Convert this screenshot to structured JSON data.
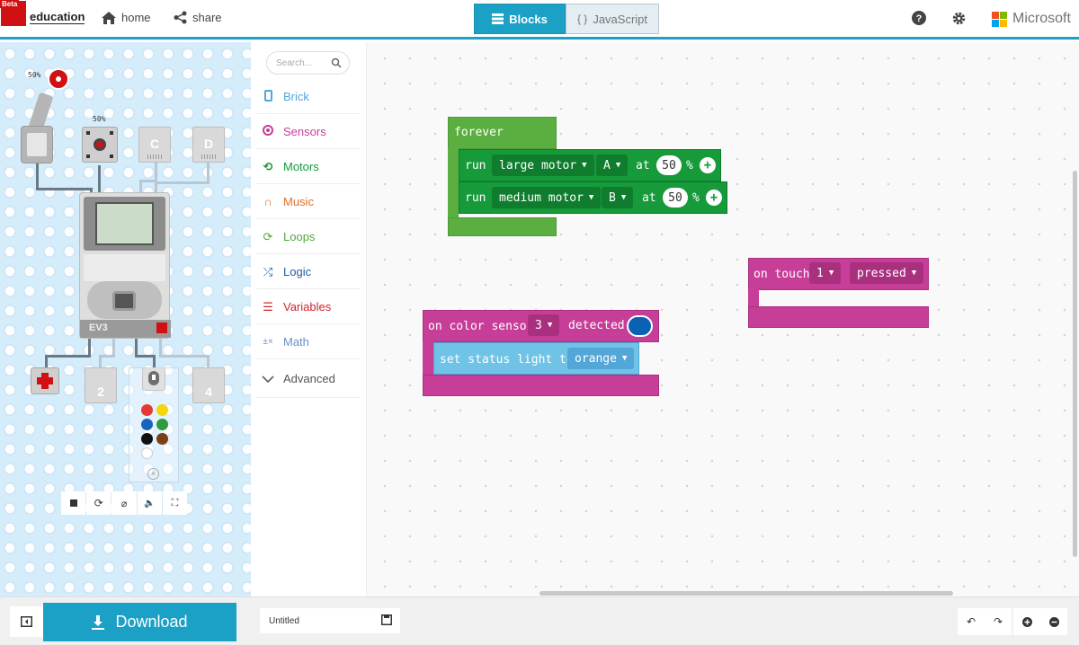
{
  "header": {
    "beta_badge": "Beta",
    "brand_text": "education",
    "home_label": "home",
    "share_label": "share",
    "tabs": [
      {
        "label": "Blocks",
        "active": true
      },
      {
        "label": "JavaScript",
        "active": false
      }
    ],
    "microsoft_label": "Microsoft",
    "accent_color": "#1ba1c6"
  },
  "simulator": {
    "motor_a_speed": "50%",
    "motor_b_speed": "50%",
    "output_ports": [
      "C",
      "D"
    ],
    "input_ports": [
      "2",
      "4"
    ],
    "brick_label": "EV3",
    "color_options": [
      "#e53935",
      "#f5d50e",
      "#1565c0",
      "#2e9b3e",
      "#111111",
      "#7b3f12",
      "#ffffff"
    ],
    "toolbar": [
      "stop-icon",
      "restart-icon",
      "mute-icon",
      "sound-icon",
      "fullscreen-icon"
    ]
  },
  "toolbox": {
    "search_placeholder": "Search...",
    "categories": [
      {
        "label": "Brick",
        "color": "#52a6d8",
        "icon": "brick-icon"
      },
      {
        "label": "Sensors",
        "color": "#c73e98",
        "icon": "sensor-icon"
      },
      {
        "label": "Motors",
        "color": "#169a3a",
        "icon": "motor-icon"
      },
      {
        "label": "Music",
        "color": "#e0702c",
        "icon": "headphones-icon"
      },
      {
        "label": "Loops",
        "color": "#4fa83c",
        "icon": "loop-icon"
      },
      {
        "label": "Logic",
        "color": "#1e5ba8",
        "icon": "logic-icon"
      },
      {
        "label": "Variables",
        "color": "#d0262e",
        "icon": "variables-icon"
      },
      {
        "label": "Math",
        "color": "#6b8fc8",
        "icon": "math-icon"
      },
      {
        "label": "Advanced",
        "color": "#555555",
        "icon": "chevron-down-icon"
      }
    ]
  },
  "workspace": {
    "forever_block": {
      "title": "forever",
      "rows": [
        {
          "verb": "run",
          "motor": "large motor",
          "port": "A",
          "at": "at",
          "speed": "50",
          "unit": "%"
        },
        {
          "verb": "run",
          "motor": "medium motor",
          "port": "B",
          "at": "at",
          "speed": "50",
          "unit": "%"
        }
      ]
    },
    "color_block": {
      "prefix": "on color sensor",
      "port": "3",
      "event": "detected",
      "color": "#0b62b4",
      "inner_prefix": "set status light to",
      "inner_value": "orange"
    },
    "touch_block": {
      "prefix": "on touch",
      "port": "1",
      "event": "pressed"
    }
  },
  "bottombar": {
    "download_label": "Download",
    "project_name": "Untitled"
  }
}
